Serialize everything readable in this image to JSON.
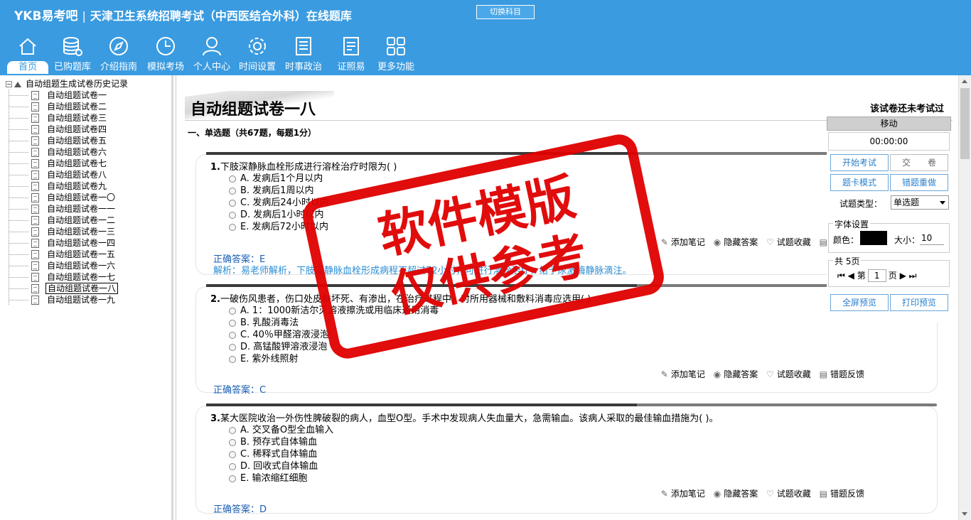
{
  "header": {
    "logo": "YKB易考吧",
    "title": "天津卫生系统招聘考试（中西医结合外科）在线题库",
    "switch_button": "切换科目"
  },
  "nav": [
    {
      "label": "首页",
      "icon": "home-icon"
    },
    {
      "label": "已购题库",
      "icon": "database-icon"
    },
    {
      "label": "介绍指南",
      "icon": "compass-icon"
    },
    {
      "label": "模拟考场",
      "icon": "clock-icon"
    },
    {
      "label": "个人中心",
      "icon": "user-icon"
    },
    {
      "label": "时间设置",
      "icon": "gear-icon"
    },
    {
      "label": "时事政治",
      "icon": "newspaper-icon"
    },
    {
      "label": "证照易",
      "icon": "checklist-icon"
    },
    {
      "label": "更多功能",
      "icon": "grid-icon"
    }
  ],
  "tree": {
    "root": "自动组题生成试卷历史记录",
    "items": [
      "自动组题试卷一",
      "自动组题试卷二",
      "自动组题试卷三",
      "自动组题试卷四",
      "自动组题试卷五",
      "自动组题试卷六",
      "自动组题试卷七",
      "自动组题试卷八",
      "自动组题试卷九",
      "自动组题试卷一〇",
      "自动组题试卷一一",
      "自动组题试卷一二",
      "自动组题试卷一三",
      "自动组题试卷一四",
      "自动组题试卷一五",
      "自动组题试卷一六",
      "自动组题试卷一七",
      "自动组题试卷一八",
      "自动组题试卷一九"
    ],
    "selected_index": 17
  },
  "main": {
    "paper_title": "自动组题试卷一八",
    "status": "该试卷还未考试过",
    "section": "一、单选题（共67题，每题1分）"
  },
  "actions": {
    "note": "添加笔记",
    "hide": "隐藏答案",
    "fav": "试题收藏",
    "report": "错题反馈"
  },
  "questions": [
    {
      "num": "1.",
      "stem": "下肢深静脉血栓形成进行溶栓治疗时限为( )",
      "options": [
        "A. 发病后1个月以内",
        "B. 发病后1周以内",
        "C. 发病后24小时以内",
        "D. 发病后1小时以内",
        "E. 发病后72小时以内"
      ],
      "answer": "正确答案：E",
      "analysis": "解析：易老师解析，下肢深静脉血栓形成病程不超过72小时，可进行溶栓治疗，给予尿激酶静脉滴注。"
    },
    {
      "num": "2.",
      "stem": "一破伤风患者，伤口处皮肤坏死、有渗出，在治疗过程中，对所用器械和敷料消毒应选用( )",
      "options": [
        "A. 1：1000新洁尔灭溶液擦洗或用临床通用消毒",
        "B. 乳酸消毒法",
        "C. 40％甲醛溶液浸泡",
        "D. 高锰酸钾溶液浸泡",
        "E. 紫外线照射"
      ],
      "answer": "正确答案：C",
      "analysis": ""
    },
    {
      "num": "3.",
      "stem": "某大医院收治一外伤性脾破裂的病人，血型O型。手术中发现病人失血量大，急需输血。该病人采取的最佳输血措施为( )。",
      "options": [
        "A. 交叉备O型全血输入",
        "B. 预存式自体输血",
        "C. 稀释式自体输血",
        "D. 回收式自体输血",
        "E. 输浓缩红细胞"
      ],
      "answer": "正确答案：D",
      "analysis": ""
    }
  ],
  "panel": {
    "move": "移动",
    "timer": "00:00:00",
    "start": "开始考试",
    "submit": "交　　卷",
    "card_mode": "题卡模式",
    "wrong_redo": "错题重做",
    "type_label": "试题类型：",
    "type_value": "单选题",
    "font_legend": "字体设置",
    "color_label": "颜色：",
    "size_label": "大小：",
    "size_value": "10",
    "color_value": "#000000",
    "pages_legend": "共 5页",
    "page_prefix": "第",
    "page_value": "1",
    "page_suffix": "页",
    "fullscreen": "全屏预览",
    "print": "打印预览"
  },
  "watermark": {
    "line1": "软件模版",
    "line2": "仅供参考"
  },
  "colors": {
    "header_bg": "#3a9be0",
    "stamp": "#e00000"
  }
}
